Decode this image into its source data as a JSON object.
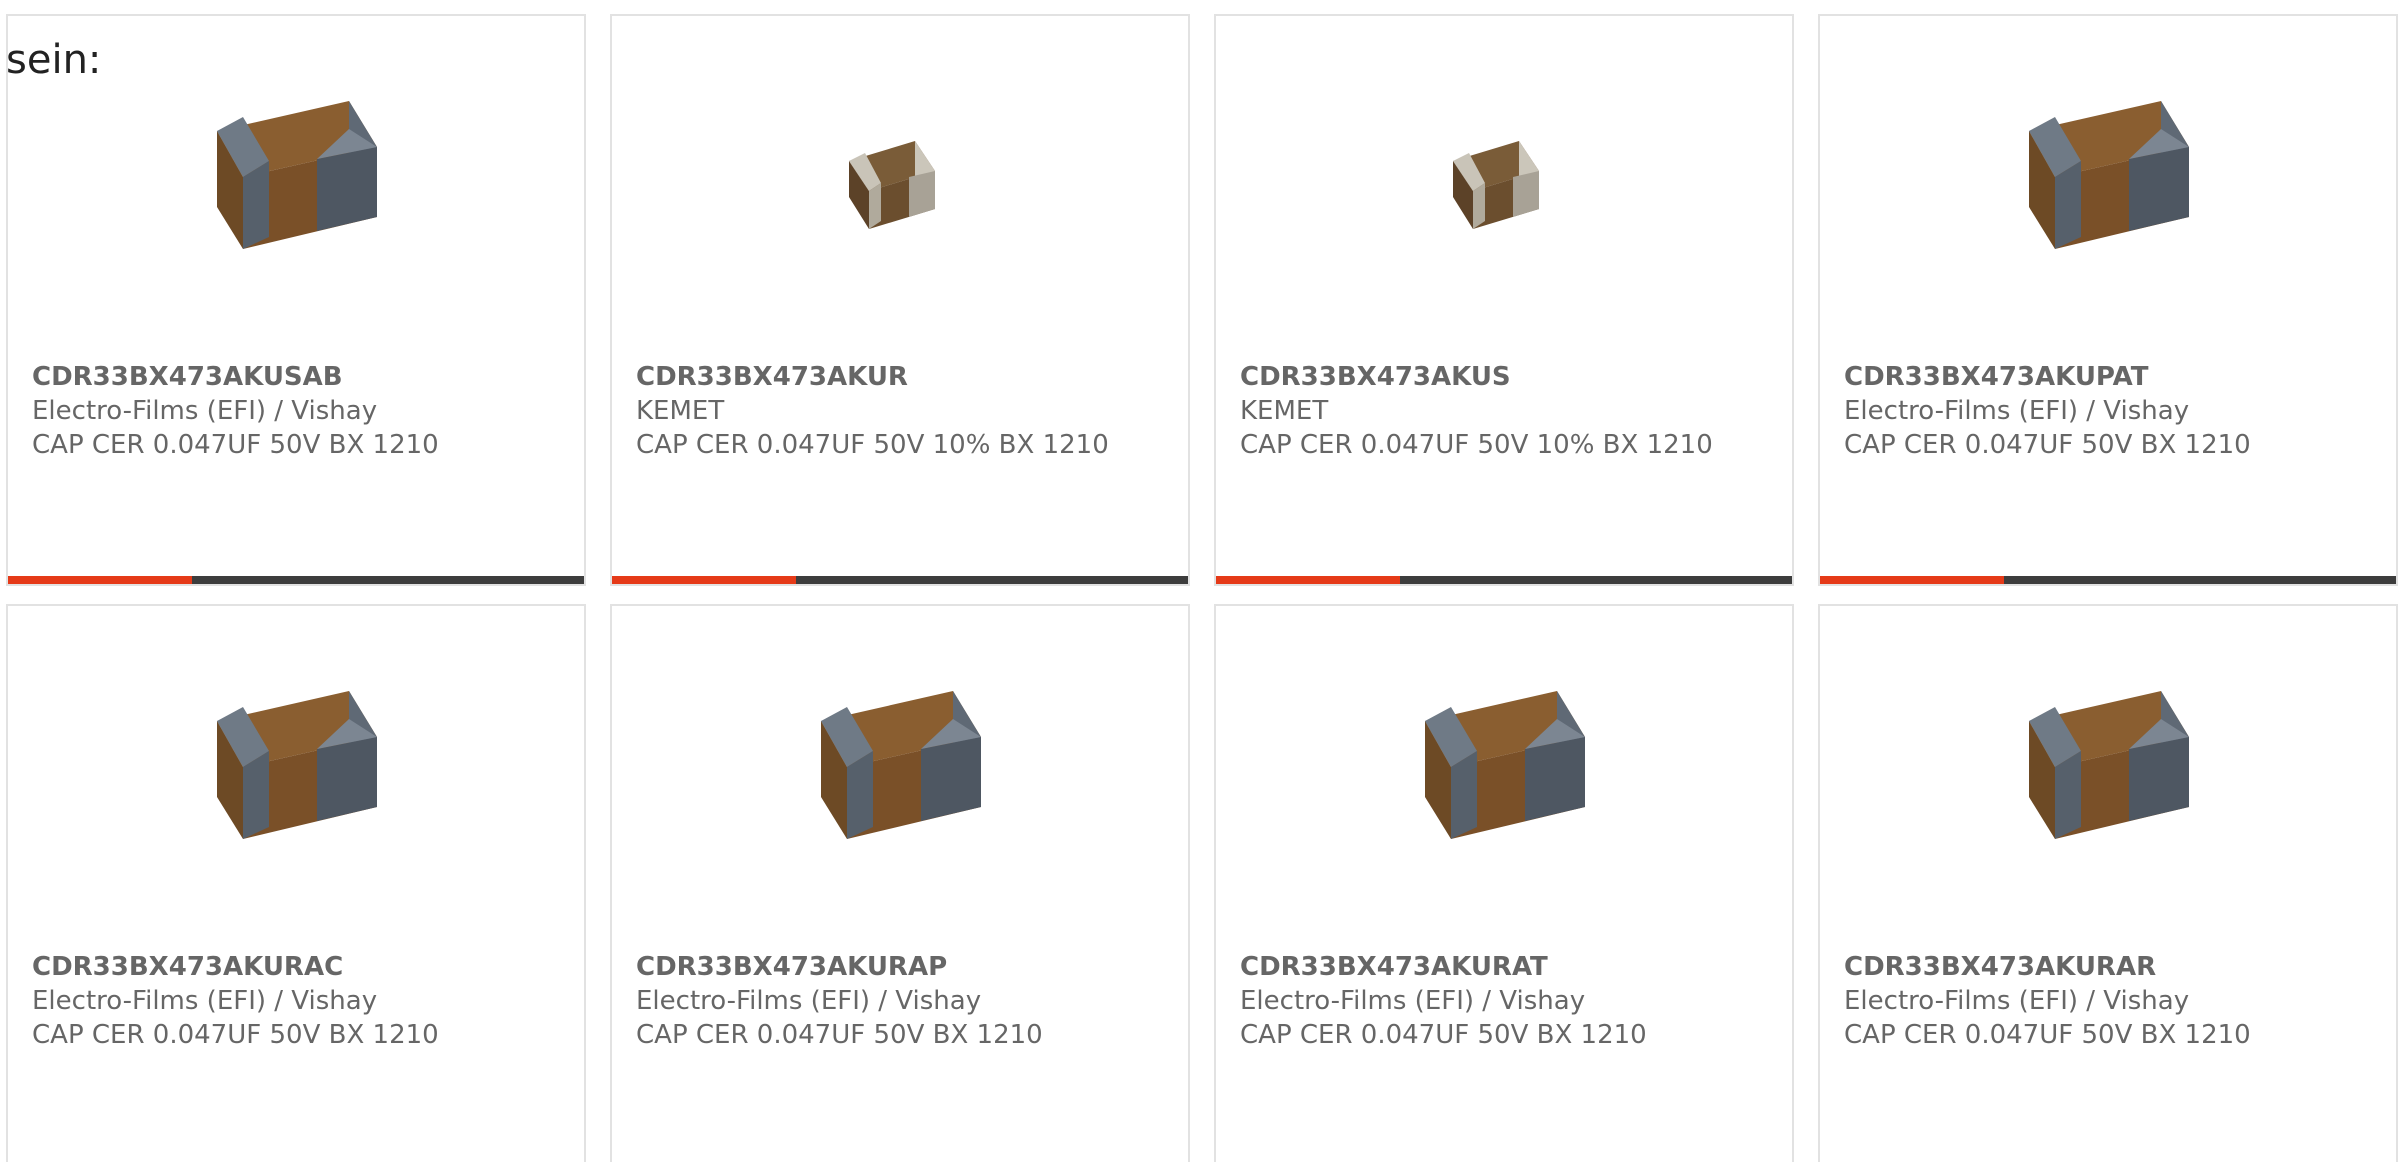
{
  "intro_text": "sein:",
  "accent_color": "#e53a18",
  "track_color": "#3d3d3d",
  "products": [
    {
      "part_number": "CDR33BX473AKUSAB",
      "manufacturer": "Electro-Films (EFI) / Vishay",
      "description": "CAP CER 0.047UF 50V BX 1210",
      "image_icon": "mlcc-capacitor-brown-icon",
      "progress": 0.32
    },
    {
      "part_number": "CDR33BX473AKUR",
      "manufacturer": "KEMET",
      "description": "CAP CER 0.047UF 50V 10% BX 1210",
      "image_icon": "mlcc-capacitor-small-icon",
      "progress": 0.32
    },
    {
      "part_number": "CDR33BX473AKUS",
      "manufacturer": "KEMET",
      "description": "CAP CER 0.047UF 50V 10% BX 1210",
      "image_icon": "mlcc-capacitor-small-icon",
      "progress": 0.32
    },
    {
      "part_number": "CDR33BX473AKUPAT",
      "manufacturer": "Electro-Films (EFI) / Vishay",
      "description": "CAP CER 0.047UF 50V BX 1210",
      "image_icon": "mlcc-capacitor-brown-icon",
      "progress": 0.32
    },
    {
      "part_number": "CDR33BX473AKURAC",
      "manufacturer": "Electro-Films (EFI) / Vishay",
      "description": "CAP CER 0.047UF 50V BX 1210",
      "image_icon": "mlcc-capacitor-brown-icon",
      "progress": null
    },
    {
      "part_number": "CDR33BX473AKURAP",
      "manufacturer": "Electro-Films (EFI) / Vishay",
      "description": "CAP CER 0.047UF 50V BX 1210",
      "image_icon": "mlcc-capacitor-brown-icon",
      "progress": null
    },
    {
      "part_number": "CDR33BX473AKURAT",
      "manufacturer": "Electro-Films (EFI) / Vishay",
      "description": "CAP CER 0.047UF 50V BX 1210",
      "image_icon": "mlcc-capacitor-brown-icon",
      "progress": null
    },
    {
      "part_number": "CDR33BX473AKURAR",
      "manufacturer": "Electro-Films (EFI) / Vishay",
      "description": "CAP CER 0.047UF 50V BX 1210",
      "image_icon": "mlcc-capacitor-brown-icon",
      "progress": null
    }
  ]
}
